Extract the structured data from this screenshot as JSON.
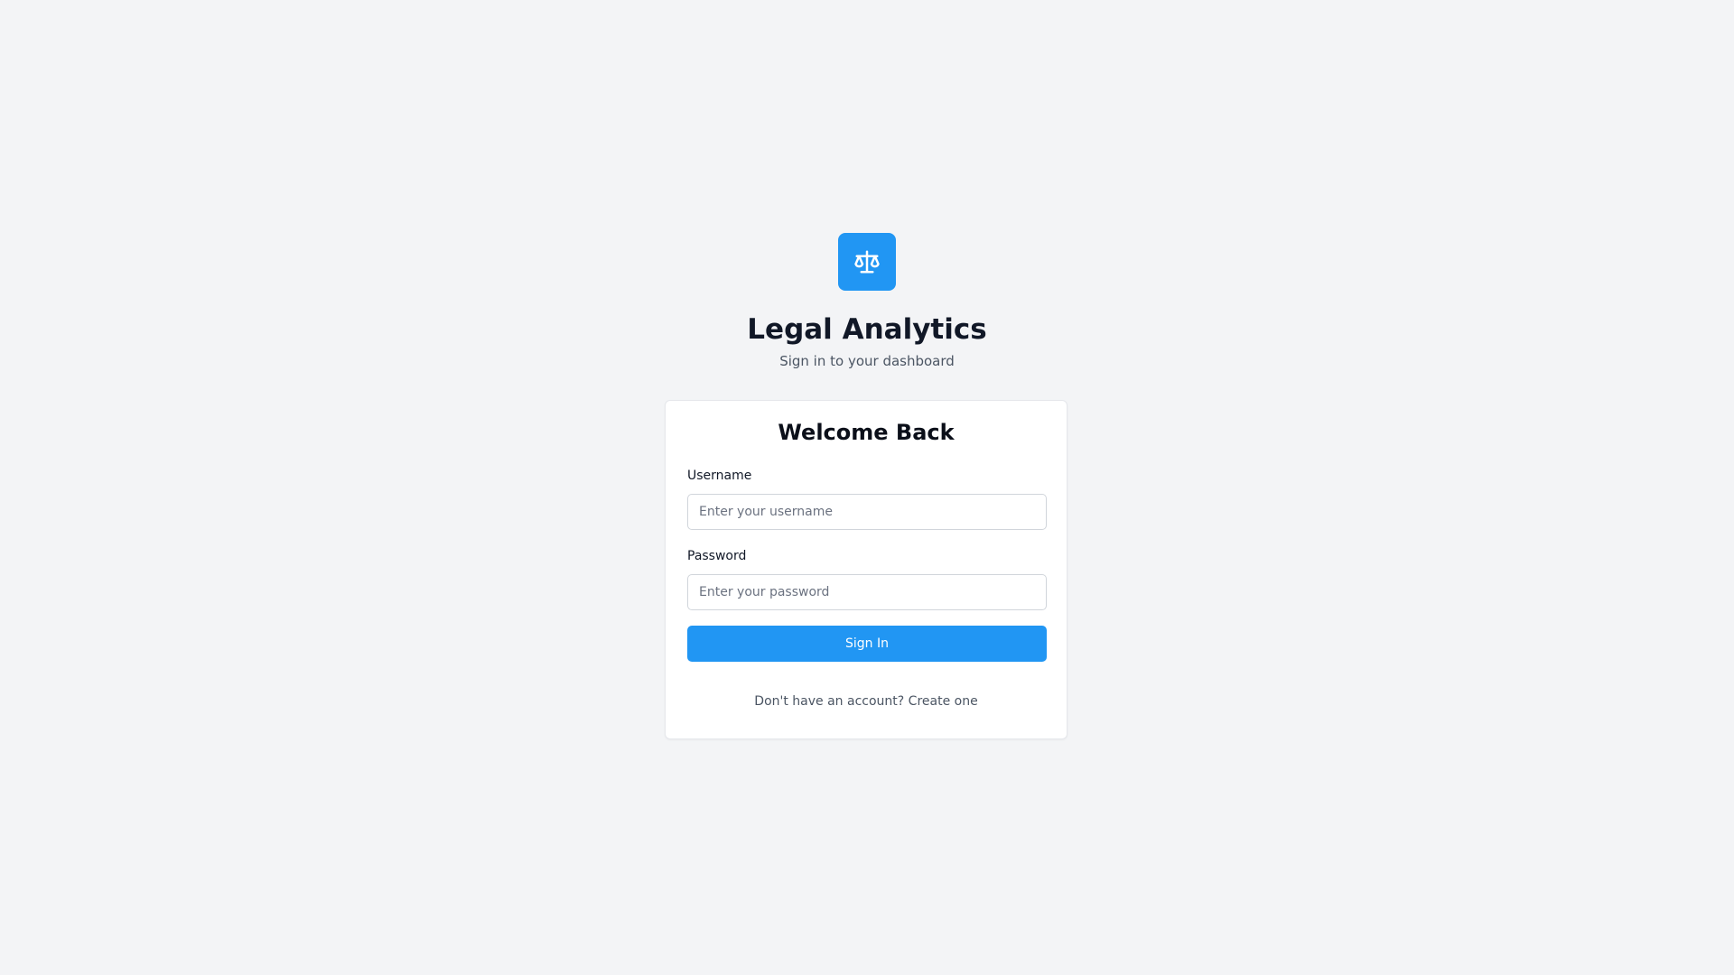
{
  "brand": {
    "logo_icon": "scale-icon",
    "title": "Legal Analytics",
    "subtitle": "Sign in to your dashboard"
  },
  "login_card": {
    "title": "Welcome Back",
    "username": {
      "label": "Username",
      "value": "",
      "placeholder": "Enter your username"
    },
    "password": {
      "label": "Password",
      "value": "",
      "placeholder": "Enter your password"
    },
    "submit_label": "Sign In",
    "signup_prompt": "Don't have an account?",
    "signup_link": "Create one"
  },
  "colors": {
    "accent": "#2196f3",
    "background": "#f3f4f6",
    "card": "#ffffff"
  }
}
